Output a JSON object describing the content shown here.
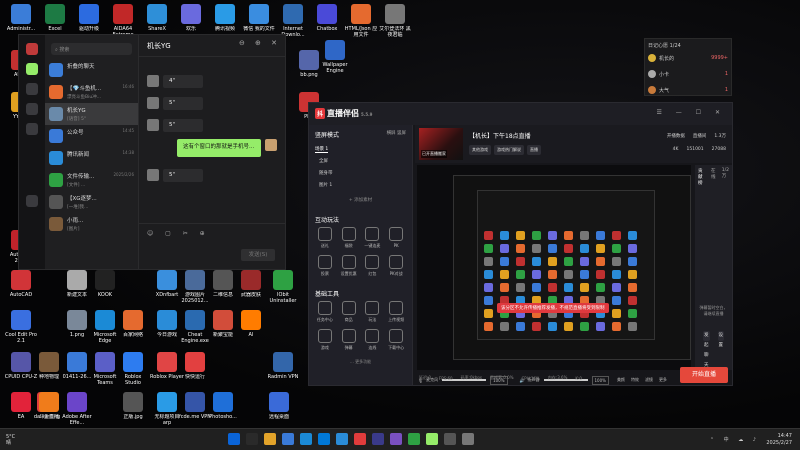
{
  "colors": {
    "accent_red": "#e5383b",
    "wechat_green": "#95ec69",
    "dark_bg": "#16161a"
  },
  "desktop": {
    "icons": [
      {
        "label": "Administr...",
        "c": "#3b7dd8"
      },
      {
        "label": "Excel",
        "c": "#1d7a44"
      },
      {
        "label": "驱动升级",
        "c": "#2c6be0"
      },
      {
        "label": "AIDA64 Extreme",
        "c": "#c12828"
      },
      {
        "label": "ShareX",
        "c": "#2e8fd8"
      },
      {
        "label": "欢乐",
        "c": "#6a6ade"
      },
      {
        "label": "腾讯视频",
        "c": "#2a9be6"
      },
      {
        "label": "微信 我的文件",
        "c": "#3a8de0"
      },
      {
        "label": "Internet Downlo...",
        "c": "#2f6ab0"
      },
      {
        "label": "Chatbox",
        "c": "#4a4ad8"
      },
      {
        "label": "HTML/Json 应用文件",
        "c": "#e56a2f"
      },
      {
        "label": "艾尔登法环 黑夜君临",
        "c": "#777"
      },
      {
        "label": "AUTO",
        "c": "#c23030"
      },
      {
        "label": "YY语音",
        "c": "#e0a020"
      },
      {
        "label": "bb.png",
        "c": "#5566aa"
      },
      {
        "label": "Wallpaper Engine",
        "c": "#2f67c7"
      },
      {
        "label": "PDF",
        "c": "#cc3333"
      },
      {
        "label": "AutoCAD 2021",
        "c": "#c0232b"
      },
      {
        "label": "AutoCAD",
        "c": "#d13438"
      },
      {
        "label": "Cool Edit Pro 2.1",
        "c": "#3a6fe0"
      },
      {
        "label": "CPUID CPU-Z",
        "c": "#5656a8"
      },
      {
        "label": "dailianting",
        "c": "#e03c3c"
      },
      {
        "label": "EA",
        "c": "#e2233a"
      },
      {
        "label": "种地物理",
        "c": "#7a5a3a"
      },
      {
        "label": "斗鱼直播",
        "c": "#f07c1b"
      },
      {
        "label": "01411-26...",
        "c": "#3a7ad8"
      },
      {
        "label": "Adobe After Effe...",
        "c": "#6b45c9"
      },
      {
        "label": "新建文本",
        "c": "#aaa"
      },
      {
        "label": "1.png",
        "c": "#7a8899"
      },
      {
        "label": "Microsoft Teams",
        "c": "#5b5fc7"
      },
      {
        "label": "KOOK",
        "c": "#222"
      },
      {
        "label": "Microsoft Edge",
        "c": "#1b8ad6"
      },
      {
        "label": "Roblox Studio",
        "c": "#2d7cf0"
      },
      {
        "label": "XDnfbart",
        "c": "#3a8fdd"
      },
      {
        "label": "百家网络",
        "c": "#e56a2f"
      },
      {
        "label": "正版.jpg",
        "c": "#555"
      },
      {
        "label": "游戏图片 2025012...",
        "c": "#4a6a9a"
      },
      {
        "label": "今日游戏",
        "c": "#2a8cd8"
      },
      {
        "label": "快快运行",
        "c": "#e24040"
      },
      {
        "label": "Roblox Player",
        "c": "#e04545"
      },
      {
        "label": "Cheat Engine.exe",
        "c": "#2a6ab0"
      },
      {
        "label": "无标题项目 arp",
        "c": "#2a9be6"
      },
      {
        "label": "二维信息",
        "c": "#555"
      },
      {
        "label": "新聚宝能",
        "c": "#d24d3a"
      },
      {
        "label": "fcde.me VPN",
        "c": "#3555a8"
      },
      {
        "label": "武器皮肤",
        "c": "#9a2a2a"
      },
      {
        "label": "AI",
        "c": "#ff7c00"
      },
      {
        "label": "Photosho...",
        "c": "#1f6fd8"
      },
      {
        "label": "IObit Uninstaller",
        "c": "#2ea143"
      },
      {
        "label": "Radmin VPN",
        "c": "#3366aa"
      },
      {
        "label": "远程桌面",
        "c": "#3a6ad8"
      }
    ]
  },
  "wechat": {
    "search_placeholder": "搜索",
    "chat_title": "机长YG",
    "send_label": "发送(S)",
    "contacts": [
      {
        "name": "折叠的聊天",
        "preview": "",
        "time": "",
        "c": "#3b7dd8"
      },
      {
        "name": "【💎斗鱼机...",
        "preview": "漂亮斗鱼Biu冲...",
        "time": "16:46",
        "c": "#e56a2f"
      },
      {
        "name": "机长YG",
        "preview": "[语音] 5\"",
        "time": "",
        "c": "#6a8aaa"
      },
      {
        "name": "公众号",
        "preview": "",
        "time": "14:45",
        "c": "#3a7ad8"
      },
      {
        "name": "腾讯新闻",
        "preview": "",
        "time": "14:38",
        "c": "#2a8cd8"
      },
      {
        "name": "文件传输...",
        "preview": "[文件] ...",
        "time": "2025/2/26",
        "c": "#2ea143"
      },
      {
        "name": "【XG逐梦...",
        "preview": "[一堆]我...",
        "time": "",
        "c": "#555"
      },
      {
        "name": "小雨...",
        "preview": "[图片]",
        "time": "",
        "c": "#7a5a3a"
      }
    ],
    "messages": [
      {
        "text": "4\""
      },
      {
        "text": "5\""
      },
      {
        "text": "5\""
      },
      {
        "text": "这有个窗口的那就是手机号...",
        "self": true
      },
      {
        "text": "5\""
      }
    ],
    "tools": "☺ ▢ ✂ ⊕"
  },
  "rank": {
    "title": "日记心愿 1/24",
    "rows": [
      {
        "label": "机长的",
        "val": "9999+",
        "c": "#d9b23a"
      },
      {
        "label": "小卡",
        "val": "1",
        "c": "#aaa"
      },
      {
        "label": "大气",
        "val": "1",
        "c": "#c87a3a"
      }
    ]
  },
  "live": {
    "app_name": "直播伴侣",
    "version": "5.5.9",
    "mode": "竖屏模式",
    "mode_tabs": "横屏 竖屏",
    "scenes": [
      "场景 1"
    ],
    "sources": [
      "全屏",
      "随身带",
      "图片 1"
    ],
    "add_source": "+ 添加素材",
    "section_interact": "互动玩法",
    "interact_tools": [
      "送礼",
      "福袋",
      "一键连麦",
      "PK",
      "投票",
      "设置优惠",
      "红包",
      "PK对战"
    ],
    "section_basic": "基础工具",
    "basic_tools": [
      "任务中心",
      "商品",
      "玩法",
      "上传视频",
      "游戏",
      "弹幕",
      "连线",
      "下载中心"
    ],
    "more": "… 更多功能",
    "stream_title": "【机长】下午18点直播",
    "thumb_tag": "已开直播搬家",
    "chips": [
      "其他游戏",
      "游戏热门解说",
      "直播"
    ],
    "stats": [
      "开播数据",
      "直播间",
      "1.3万"
    ],
    "stats2": [
      "4K",
      "151001",
      "27088"
    ],
    "notice": "该分区不允许传播推荐发播，不规范直播将受到限制",
    "chat_tabs": [
      "贡献榜",
      "在线",
      "1/2万"
    ],
    "chat_hint": "弹幕暂时空白，请继续直播",
    "chat_btns": [
      "发起聊天",
      "设置"
    ],
    "mic_label": "麦克风",
    "mic_vol": "100%",
    "spk_label": "扬声器",
    "spk_vol": "100%",
    "right_tools": [
      "美颜",
      "特效",
      "滤镜",
      "更多"
    ],
    "go_live": "开始直播",
    "status": [
      "延迟:0",
      "FPS:60",
      "码率:0kbps",
      "丢帧率:0.0%",
      "CPU:16%",
      "内存:3.6%",
      "K:0"
    ]
  },
  "taskbar": {
    "weather_temp": "5°C",
    "weather_desc": "晴",
    "time": "14:47",
    "date": "2025/2/27",
    "tray": "⌃ 中 ☁ ♪"
  }
}
